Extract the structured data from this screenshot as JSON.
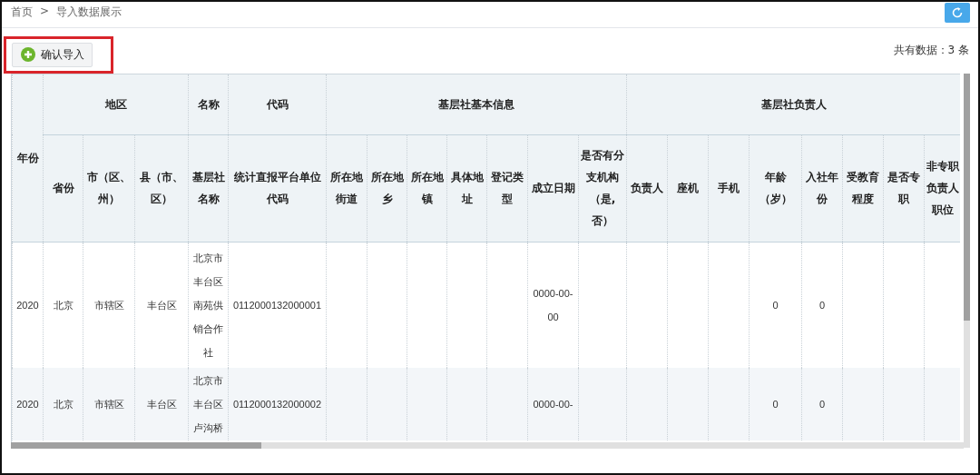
{
  "breadcrumb": [
    {
      "label": "首页"
    },
    {
      "label": "导入数据展示"
    }
  ],
  "breadcrumb_separator": ">",
  "toolbar": {
    "button": "确认导入",
    "count": "共有数据：3 条"
  },
  "table": {
    "column_groups": [
      {
        "label": "年份"
      },
      {
        "label": "地区",
        "columns": [
          "省份",
          "市（区、州）",
          "县（市、区）"
        ]
      },
      {
        "label": "名称",
        "columns": [
          "基层社名称"
        ]
      },
      {
        "label": "代码",
        "columns": [
          "统计直报平台单位代码"
        ]
      },
      {
        "label": "基层社基本信息",
        "columns": [
          "所在地街道",
          "所在地乡",
          "所在地镇",
          "具体地址",
          "登记类型",
          "成立日期",
          "是否有分支机构（是,否）"
        ]
      },
      {
        "label": "基层社负责人",
        "columns": [
          "负责人",
          "座机",
          "手机",
          "年龄（岁）",
          "入社年份",
          "受教育程度",
          "是否专职",
          "非专职负责人职位"
        ]
      }
    ],
    "rows": [
      {
        "cells": [
          "2020",
          "北京",
          "市辖区",
          "丰台区",
          "北京市丰台区南苑供销合作社",
          "0112000132000001",
          null,
          null,
          null,
          null,
          null,
          "0000-00-00",
          null,
          null,
          null,
          null,
          "0",
          "0",
          null,
          null,
          null
        ]
      },
      {
        "cells": [
          "2020",
          "北京",
          "市辖区",
          "丰台区",
          "北京市丰台区卢沟桥",
          "0112000132000002",
          null,
          null,
          null,
          null,
          null,
          "0000-00-",
          null,
          null,
          null,
          null,
          "0",
          "0",
          null,
          null,
          null
        ]
      }
    ]
  }
}
